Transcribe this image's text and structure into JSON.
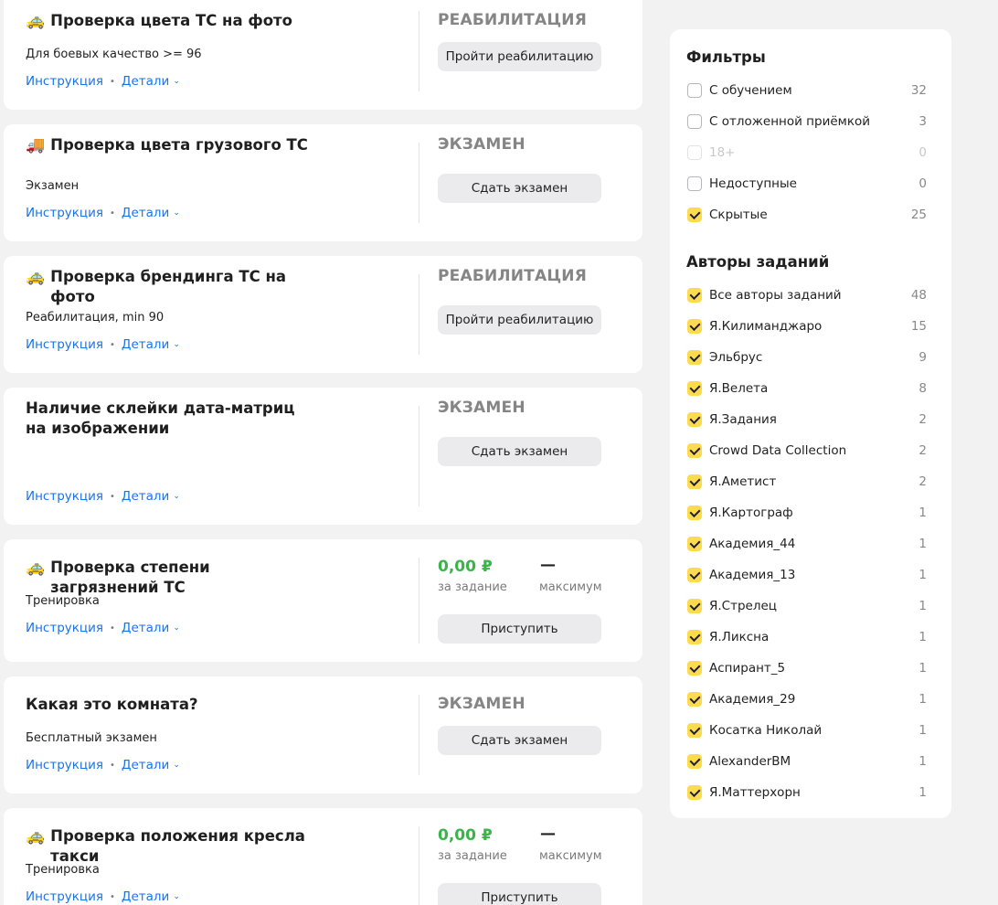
{
  "colors": {
    "link": "#1a73e8",
    "price_green": "#3bb34b",
    "checkbox_yellow": "#fcdb4f",
    "status_gray": "#858585"
  },
  "links": {
    "instruction": "Инструкция",
    "details": "Детали"
  },
  "cards": [
    {
      "emoji": "🚕",
      "title": "Проверка цвета ТС на фото",
      "subtitle": "Для боевых качество >= 96",
      "status": "РЕАБИЛИТАЦИЯ",
      "button": "Пройти реабилитацию"
    },
    {
      "emoji": "🚚",
      "title": "Проверка цвета грузового ТС",
      "subtitle": "Экзамен",
      "status": "ЭКЗАМЕН",
      "button": "Сдать экзамен"
    },
    {
      "emoji": "🚕",
      "title": "Проверка брендинга ТС на фото",
      "subtitle": "Реабилитация, min 90",
      "status": "РЕАБИЛИТАЦИЯ",
      "button": "Пройти реабилитацию"
    },
    {
      "emoji": "",
      "title": "Наличие склейки дата-матриц на изображении",
      "subtitle": "",
      "status": "ЭКЗАМЕН",
      "button": "Сдать экзамен"
    },
    {
      "emoji": "🚕",
      "title": "Проверка степени загрязнений ТС",
      "subtitle": "Тренировка",
      "price": "0,00 ₽",
      "price_caption": "за задание",
      "max": "—",
      "max_caption": "максимум",
      "button": "Приступить"
    },
    {
      "emoji": "",
      "title": "Какая это комната?",
      "subtitle": "Бесплатный экзамен",
      "status": "ЭКЗАМЕН",
      "button": "Сдать экзамен"
    },
    {
      "emoji": "🚕",
      "title": "Проверка положения кресла такси",
      "subtitle": "Тренировка",
      "price": "0,00 ₽",
      "price_caption": "за задание",
      "max": "—",
      "max_caption": "максимум",
      "button": "Приступить"
    }
  ],
  "filters": {
    "title": "Фильтры",
    "items": [
      {
        "label": "С обучением",
        "count": "32",
        "checked": false,
        "disabled": false
      },
      {
        "label": "С отложенной приёмкой",
        "count": "3",
        "checked": false,
        "disabled": false
      },
      {
        "label": "18+",
        "count": "0",
        "checked": false,
        "disabled": true
      },
      {
        "label": "Недоступные",
        "count": "0",
        "checked": false,
        "disabled": false
      },
      {
        "label": "Скрытые",
        "count": "25",
        "checked": true,
        "disabled": false
      }
    ]
  },
  "authors": {
    "title": "Авторы заданий",
    "items": [
      {
        "label": "Все авторы заданий",
        "count": "48"
      },
      {
        "label": "Я.Килиманджаро",
        "count": "15"
      },
      {
        "label": "Эльбрус",
        "count": "9"
      },
      {
        "label": "Я.Велета",
        "count": "8"
      },
      {
        "label": "Я.Задания",
        "count": "2"
      },
      {
        "label": "Crowd Data Collection",
        "count": "2"
      },
      {
        "label": "Я.Аметист",
        "count": "2"
      },
      {
        "label": "Я.Картограф",
        "count": "1"
      },
      {
        "label": "Академия_44",
        "count": "1"
      },
      {
        "label": "Академия_13",
        "count": "1"
      },
      {
        "label": "Я.Стрелец",
        "count": "1"
      },
      {
        "label": "Я.Ликсна",
        "count": "1"
      },
      {
        "label": "Аспирант_5",
        "count": "1"
      },
      {
        "label": "Академия_29",
        "count": "1"
      },
      {
        "label": "Косатка Николай",
        "count": "1"
      },
      {
        "label": "AlexanderBM",
        "count": "1"
      },
      {
        "label": "Я.Маттерхорн",
        "count": "1"
      }
    ]
  }
}
